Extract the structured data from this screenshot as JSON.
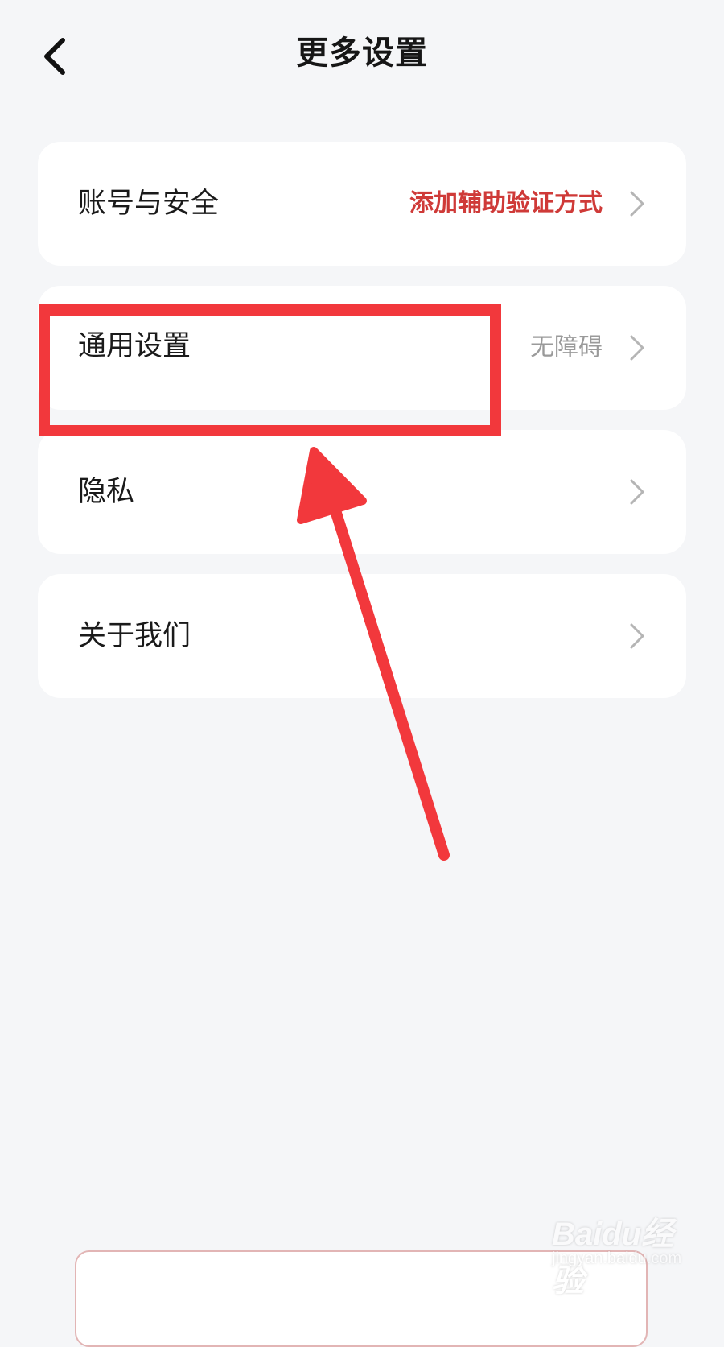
{
  "header": {
    "title": "更多设置",
    "back_icon": "chevron-left-icon"
  },
  "settings": [
    {
      "label": "账号与安全",
      "hint": "添加辅助验证方式",
      "hint_color": "#cf3a38"
    },
    {
      "label": "通用设置",
      "hint": "无障碍",
      "hint_color": "#9a9a9a"
    },
    {
      "label": "隐私",
      "hint": ""
    },
    {
      "label": "关于我们",
      "hint": ""
    }
  ],
  "footer": {
    "logout_label": ""
  },
  "annotation": {
    "highlight_color": "#f2383c",
    "highlighted_item": "通用设置"
  },
  "watermark": {
    "brand": "Baidu经验",
    "url": "jingyan.baidu.com"
  },
  "colors": {
    "background": "#f5f6f8",
    "card": "#ffffff",
    "accent_red": "#cf3a38"
  }
}
